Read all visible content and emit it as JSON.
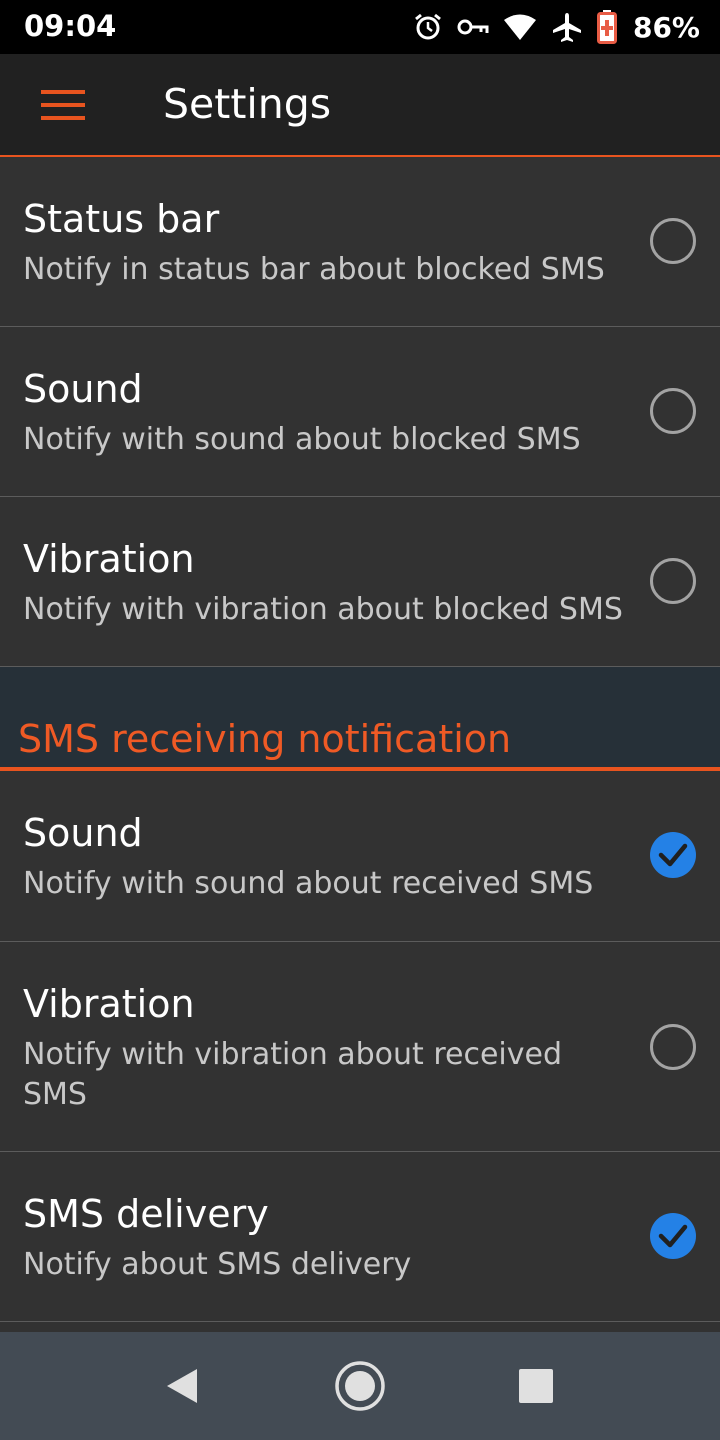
{
  "status_bar": {
    "time": "09:04",
    "battery_percent": "86%",
    "icons": [
      "alarm-icon",
      "vpn-key-icon",
      "wifi-icon",
      "airplane-icon",
      "battery-charging-icon"
    ]
  },
  "app_bar": {
    "title": "Settings",
    "accent_color": "#e8541f"
  },
  "blocked_sms_notification": {
    "items": [
      {
        "title": "Status bar",
        "summary": "Notify in status bar about blocked SMS",
        "checked": false
      },
      {
        "title": "Sound",
        "summary": "Notify with sound about blocked SMS",
        "checked": false
      },
      {
        "title": "Vibration",
        "summary": "Notify with vibration about blocked SMS",
        "checked": false
      }
    ]
  },
  "sms_receiving_notification": {
    "header": "SMS receiving notification",
    "items": [
      {
        "title": "Sound",
        "summary": "Notify with sound about received SMS",
        "checked": true
      },
      {
        "title": "Vibration",
        "summary": "Notify with vibration about received SMS",
        "checked": false
      },
      {
        "title": "SMS delivery",
        "summary": "Notify about SMS delivery",
        "checked": true
      }
    ]
  },
  "nav_bar": {
    "buttons": [
      "back-icon",
      "home-icon",
      "recents-icon"
    ]
  }
}
